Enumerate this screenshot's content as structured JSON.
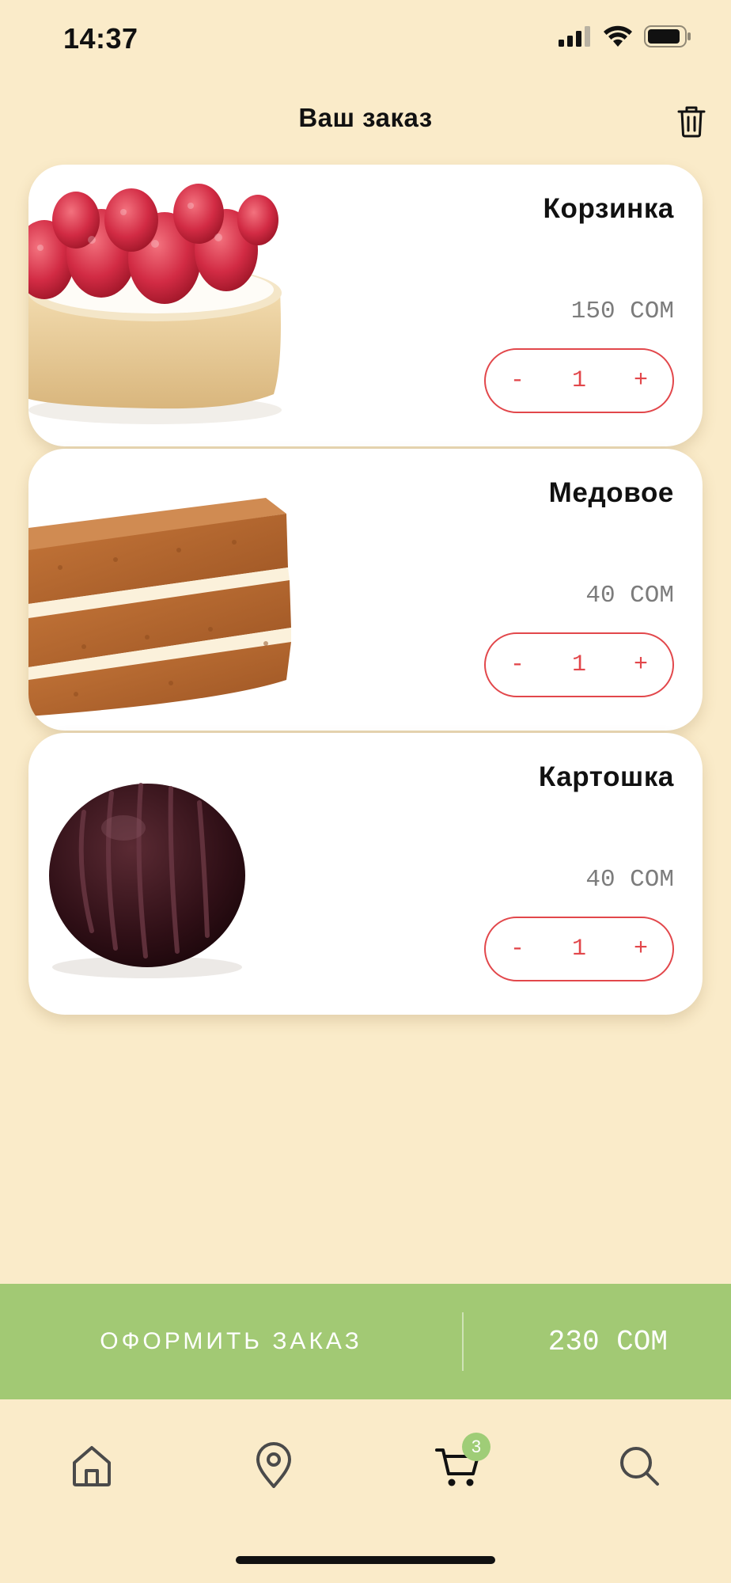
{
  "status_bar": {
    "time": "14:37",
    "icons": [
      "signal-icon",
      "wifi-icon",
      "battery-icon"
    ]
  },
  "header": {
    "title": "Ваш заказ",
    "action_icon": "trash-icon"
  },
  "cart_items": [
    {
      "name": "Корзинка",
      "price": "150 СОМ",
      "quantity": "1",
      "minus": "-",
      "plus": "+",
      "image": "raspberry-tart"
    },
    {
      "name": "Медовое",
      "price": "40 СОМ",
      "quantity": "1",
      "minus": "-",
      "plus": "+",
      "image": "honey-cake"
    },
    {
      "name": "Картошка",
      "price": "40 СОМ",
      "quantity": "1",
      "minus": "-",
      "plus": "+",
      "image": "chocolate-potato-cake"
    }
  ],
  "checkout": {
    "label": "ОФОРМИТЬ ЗАКАЗ",
    "total": "230 СОМ"
  },
  "tab_bar": {
    "tabs": [
      {
        "icon": "home-icon"
      },
      {
        "icon": "location-pin-icon"
      },
      {
        "icon": "cart-icon",
        "active": true
      },
      {
        "icon": "search-icon"
      }
    ],
    "cart_badge": "3"
  },
  "colors": {
    "background": "#faebc9",
    "accent_red": "#e2474b",
    "checkout_green": "#a2c974",
    "price_gray": "#7c7c7c"
  }
}
